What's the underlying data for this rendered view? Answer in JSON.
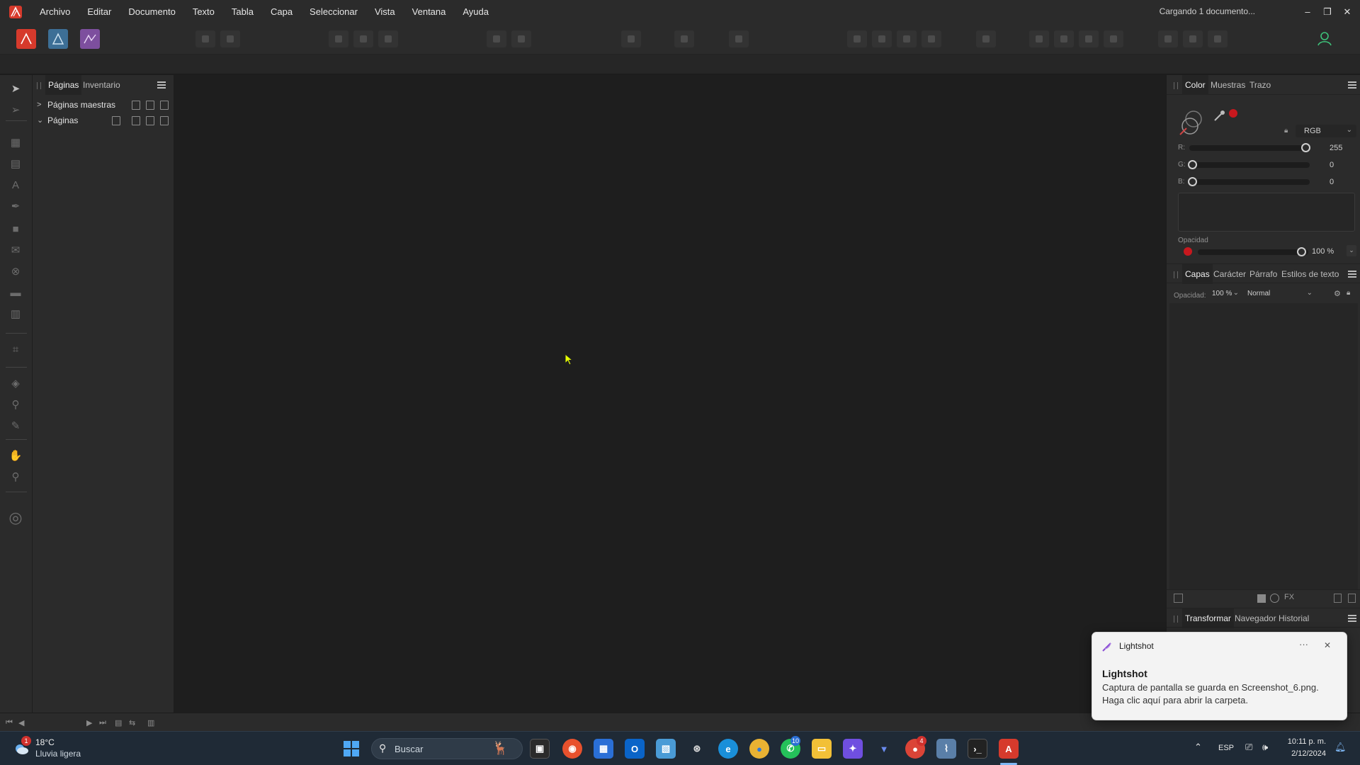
{
  "menubar": {
    "items": [
      "Archivo",
      "Editar",
      "Documento",
      "Texto",
      "Tabla",
      "Capa",
      "Seleccionar",
      "Vista",
      "Ventana",
      "Ayuda"
    ],
    "status": "Cargando 1 documento...",
    "minimize": "–",
    "restore": "❐",
    "close": "✕"
  },
  "pages_panel": {
    "tabs": [
      "Páginas",
      "Inventario"
    ],
    "rows": [
      {
        "chevron": ">",
        "label": "Páginas maestras"
      },
      {
        "chevron": "⌄",
        "label": "Páginas"
      }
    ]
  },
  "color_panel": {
    "tabs": [
      "Color",
      "Muestras",
      "Trazo"
    ],
    "mode": "RGB",
    "channels": [
      {
        "label": "R:",
        "value": "255",
        "fraction": 1.0
      },
      {
        "label": "G:",
        "value": "0",
        "fraction": 0.0
      },
      {
        "label": "B:",
        "value": "0",
        "fraction": 0.0
      }
    ],
    "opacity_label": "Opacidad",
    "opacity_value": "100 %",
    "swatch_color": "#c8181e"
  },
  "layers_panel": {
    "tabs": [
      "Capas",
      "Carácter",
      "Párrafo",
      "Estilos de texto"
    ],
    "opacity_label": "Opacidad:",
    "opacity_value": "100 %",
    "blend_mode": "Normal",
    "fx_label": "FX"
  },
  "bottom_panel": {
    "tabs": [
      "Transformar",
      "Navegador",
      "Historial"
    ]
  },
  "notification": {
    "app": "Lightshot",
    "more": "···",
    "close": "✕",
    "title": "Lightshot",
    "line1": "Captura de pantalla se guarda en Screenshot_6.png.",
    "line2": "Haga clic aquí para abrir la carpeta."
  },
  "taskbar": {
    "weather_temp": "18°C",
    "weather_desc": "Lluvia ligera",
    "weather_badge": "1",
    "search_placeholder": "Buscar",
    "whatsapp_badge": "10",
    "chrome_badge": "4",
    "language": "ESP",
    "time": "10:11 p. m.",
    "date": "2/12/2024"
  },
  "colors": {
    "accent": "#d63a2c",
    "panel": "#2b2b2b",
    "canvas": "#1e1e1e"
  }
}
